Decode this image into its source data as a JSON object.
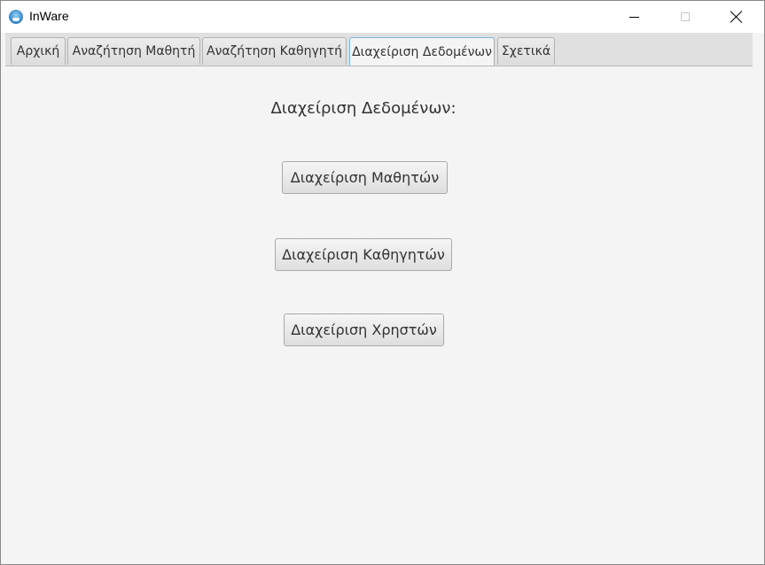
{
  "window": {
    "title": "InWare"
  },
  "tabs": [
    {
      "label": "Αρχική",
      "active": false
    },
    {
      "label": "Αναζήτηση Μαθητή",
      "active": false
    },
    {
      "label": "Αναζήτηση Καθηγητή",
      "active": false
    },
    {
      "label": "Διαχείριση Δεδομένων",
      "active": true
    },
    {
      "label": "Σχετικά",
      "active": false
    }
  ],
  "main": {
    "heading": "Διαχείριση Δεδομένων:",
    "buttons": {
      "students": "Διαχείριση Μαθητών",
      "teachers": "Διαχείριση Καθηγητών",
      "users": "Διαχείριση Χρηστών"
    }
  },
  "colors": {
    "active_tab_border": "#7fb6d9",
    "background": "#f4f4f4"
  }
}
